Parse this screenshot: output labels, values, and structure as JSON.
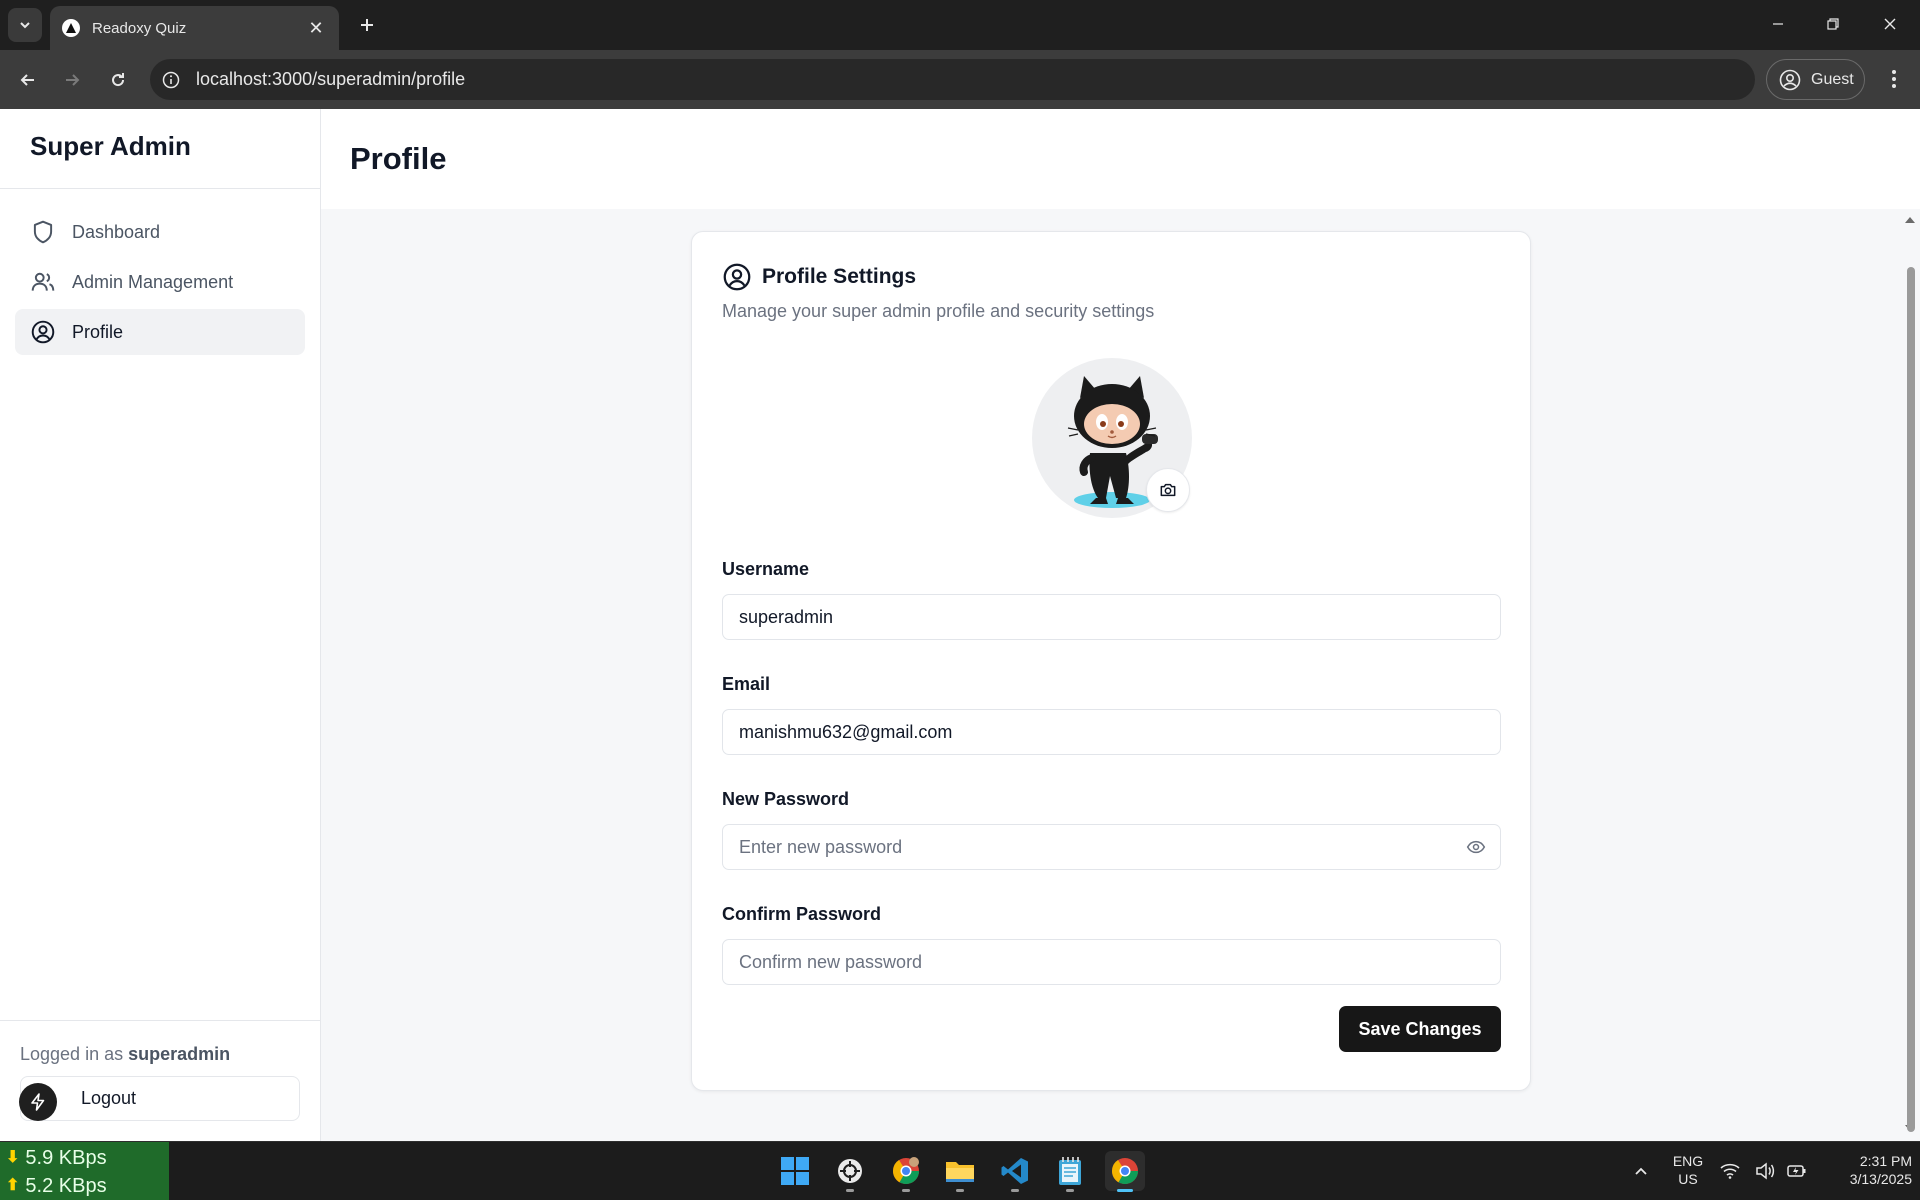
{
  "browser": {
    "tab_title": "Readoxy Quiz",
    "url": "localhost:3000/superadmin/profile",
    "profile_label": "Guest"
  },
  "sidebar": {
    "brand": "Super Admin",
    "items": [
      {
        "label": "Dashboard",
        "icon": "shield-icon"
      },
      {
        "label": "Admin Management",
        "icon": "users-icon"
      },
      {
        "label": "Profile",
        "icon": "user-circle-icon",
        "active": true
      }
    ],
    "logged_in_prefix": "Logged in as",
    "logged_in_user": "superadmin",
    "logout_label": "Logout"
  },
  "page": {
    "title": "Profile"
  },
  "card": {
    "title": "Profile Settings",
    "subtitle": "Manage your super admin profile and security settings",
    "fields": {
      "username": {
        "label": "Username",
        "value": "superadmin"
      },
      "email": {
        "label": "Email",
        "value": "manishmu632@gmail.com"
      },
      "new_password": {
        "label": "New Password",
        "placeholder": "Enter new password"
      },
      "confirm_password": {
        "label": "Confirm Password",
        "placeholder": "Confirm new password"
      }
    },
    "save_label": "Save Changes"
  },
  "taskbar": {
    "download_speed": "5.9 KBps",
    "upload_speed": "5.2 KBps",
    "lang_primary": "ENG",
    "lang_secondary": "US",
    "time": "2:31 PM",
    "date": "3/13/2025"
  },
  "colors": {
    "accent": "#171717",
    "active_nav_bg": "#f1f2f4",
    "netspeed_bg": "#1f6b2a"
  }
}
